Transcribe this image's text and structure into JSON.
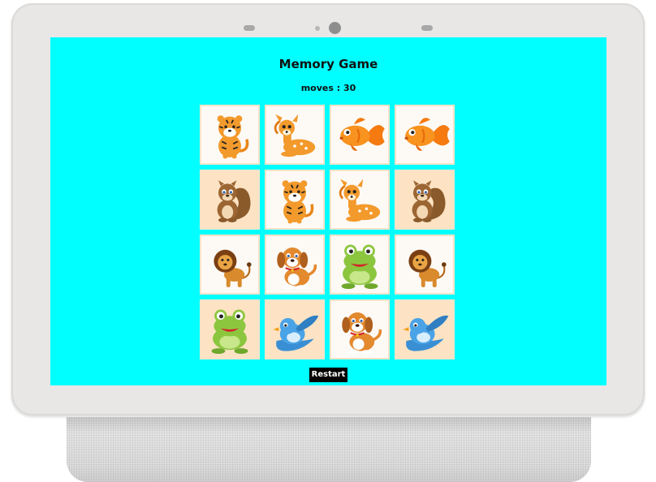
{
  "game": {
    "title": "Memory Game",
    "moves_text": "moves : 30",
    "restart_label": "Restart"
  },
  "board": {
    "rows": 4,
    "columns": 4,
    "cards": [
      {
        "animal": "tiger",
        "icon": "tiger-icon"
      },
      {
        "animal": "deer",
        "icon": "deer-icon"
      },
      {
        "animal": "goldfish",
        "icon": "goldfish-icon"
      },
      {
        "animal": "goldfish",
        "icon": "goldfish-icon"
      },
      {
        "animal": "squirrel",
        "icon": "squirrel-icon"
      },
      {
        "animal": "tiger",
        "icon": "tiger-icon"
      },
      {
        "animal": "deer",
        "icon": "deer-icon"
      },
      {
        "animal": "squirrel",
        "icon": "squirrel-icon"
      },
      {
        "animal": "lion",
        "icon": "lion-icon"
      },
      {
        "animal": "puppy",
        "icon": "puppy-icon"
      },
      {
        "animal": "frog",
        "icon": "frog-icon"
      },
      {
        "animal": "lion",
        "icon": "lion-icon"
      },
      {
        "animal": "frog",
        "icon": "frog-icon"
      },
      {
        "animal": "bluebird",
        "icon": "bluebird-icon"
      },
      {
        "animal": "puppy",
        "icon": "puppy-icon"
      },
      {
        "animal": "bluebird",
        "icon": "bluebird-icon"
      }
    ]
  },
  "colors": {
    "screen_background": "#00ffff",
    "button_background": "#000000",
    "button_text": "#ffffff",
    "card_border": "#fde4c8"
  }
}
